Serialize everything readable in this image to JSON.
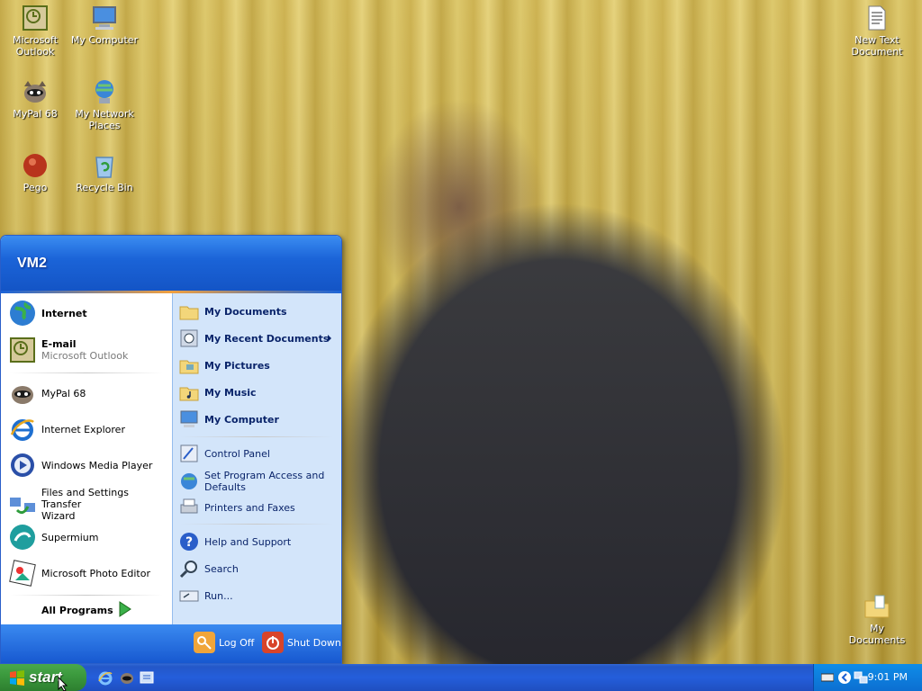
{
  "desktop": {
    "icons": [
      {
        "label_line1": "Microsoft",
        "label_line2": "Outlook",
        "icon": "outlook-icon"
      },
      {
        "label_line1": "My Computer",
        "label_line2": "",
        "icon": "my-computer-icon"
      },
      {
        "label_line1": "MyPal 68",
        "label_line2": "",
        "icon": "mypal-icon"
      },
      {
        "label_line1": "My Network",
        "label_line2": "Places",
        "icon": "network-places-icon"
      },
      {
        "label_line1": "Pego",
        "label_line2": "",
        "icon": "pego-icon"
      },
      {
        "label_line1": "Recycle Bin",
        "label_line2": "",
        "icon": "recycle-bin-icon"
      },
      {
        "label_line1": "New Text",
        "label_line2": "Document",
        "icon": "text-document-icon"
      },
      {
        "label_line1": "My Documents",
        "label_line2": "",
        "icon": "my-documents-folder-icon"
      }
    ]
  },
  "start_menu": {
    "user_name": "VM2",
    "left_items": [
      {
        "label": "Internet",
        "sub": "",
        "icon": "globe-icon"
      },
      {
        "label": "E-mail",
        "sub": "Microsoft Outlook",
        "icon": "outlook-icon"
      },
      {
        "label": "MyPal 68",
        "sub": "",
        "icon": "mypal-icon"
      },
      {
        "label": "Internet Explorer",
        "sub": "",
        "icon": "ie-icon"
      },
      {
        "label": "Windows Media Player",
        "sub": "",
        "icon": "media-player-icon"
      },
      {
        "label": "Files and Settings Transfer",
        "sub": "Wizard",
        "icon": "transfer-wizard-icon"
      },
      {
        "label": "Supermium",
        "sub": "",
        "icon": "supermium-icon"
      },
      {
        "label": "Microsoft Photo Editor",
        "sub": "",
        "icon": "photo-editor-icon"
      }
    ],
    "all_programs": "All Programs",
    "right_items": [
      {
        "label": "My Documents",
        "icon": "folder-icon"
      },
      {
        "label": "My Recent Documents",
        "icon": "recent-docs-icon"
      },
      {
        "label": "My Pictures",
        "icon": "pictures-folder-icon"
      },
      {
        "label": "My Music",
        "icon": "music-folder-icon"
      },
      {
        "label": "My Computer",
        "icon": "my-computer-icon"
      },
      {
        "label": "Control Panel",
        "icon": "control-panel-icon"
      },
      {
        "label": "Set Program Access and",
        "label2": "Defaults",
        "icon": "program-access-icon"
      },
      {
        "label": "Printers and Faxes",
        "icon": "printer-icon"
      },
      {
        "label": "Help and Support",
        "icon": "help-icon"
      },
      {
        "label": "Search",
        "icon": "search-icon"
      },
      {
        "label": "Run...",
        "icon": "run-icon"
      }
    ],
    "log_off": "Log Off",
    "shut_down": "Shut Down"
  },
  "taskbar": {
    "start_label": "start",
    "quick_launch": [
      "ie-icon",
      "mypal-icon",
      "show-desktop-icon"
    ],
    "clock": "9:01 PM"
  }
}
